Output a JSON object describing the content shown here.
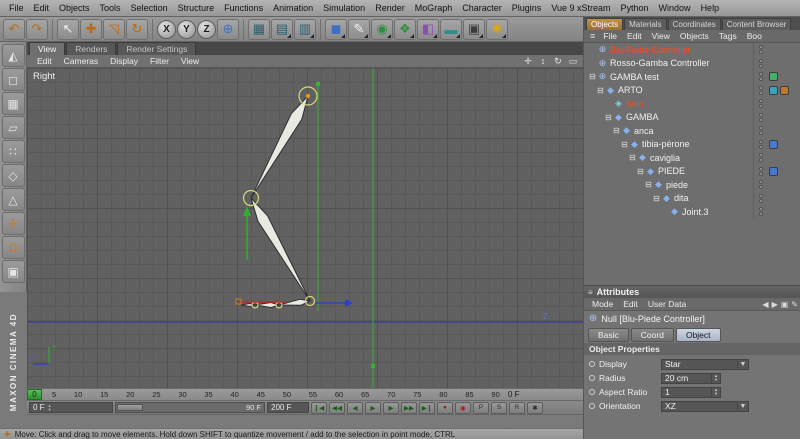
{
  "menubar": {
    "items": [
      "File",
      "Edit",
      "Objects",
      "Tools",
      "Selection",
      "Structure",
      "Functions",
      "Animation",
      "Simulation",
      "Render",
      "MoGraph",
      "Character",
      "Plugins",
      "Vue 9 xStream",
      "Python",
      "Window",
      "Help"
    ]
  },
  "toolbar": {
    "axis_x": "X",
    "axis_y": "Y",
    "axis_z": "Z"
  },
  "left_toolbar_icons": [
    "◭",
    "◻",
    "▦",
    "▱",
    "∷",
    "◇",
    "△",
    "✛",
    "Ω",
    "▣"
  ],
  "viewport": {
    "tabs": [
      "View",
      "Renders",
      "Render Settings"
    ],
    "active_tab": "View",
    "menu": [
      "Edit",
      "Cameras",
      "Display",
      "Filter",
      "View"
    ],
    "view_label": "Right",
    "axis_label_z": "Z"
  },
  "object_manager": {
    "tabs": [
      "Objects",
      "Materials",
      "Coordinates",
      "Content Browser"
    ],
    "active_tab": "Objects",
    "menu": [
      "File",
      "Edit",
      "View",
      "Objects",
      "Tags",
      "Boo"
    ],
    "tree": [
      {
        "label": "Blu-Piede Controller",
        "depth": 0,
        "icon": "null",
        "selected": true,
        "tags": []
      },
      {
        "label": "Rosso-Gamba Controller",
        "depth": 0,
        "icon": "null",
        "selected": false,
        "tags": []
      },
      {
        "label": "GAMBA test",
        "depth": 0,
        "icon": "null",
        "selected": false,
        "tags": [
          "display"
        ]
      },
      {
        "label": "ARTO",
        "depth": 1,
        "icon": "joint",
        "selected": false,
        "tags": [
          "weight",
          "xpresso"
        ]
      },
      {
        "label": "Skin",
        "depth": 2,
        "icon": "skin",
        "selected": true,
        "tags": []
      },
      {
        "label": "GAMBA",
        "depth": 2,
        "icon": "joint",
        "selected": false,
        "tags": []
      },
      {
        "label": "anca",
        "depth": 3,
        "icon": "joint",
        "selected": false,
        "tags": []
      },
      {
        "label": "tibia-pérone",
        "depth": 4,
        "icon": "joint",
        "selected": false,
        "tags": [
          "ik"
        ]
      },
      {
        "label": "caviglia",
        "depth": 5,
        "icon": "joint",
        "selected": false,
        "tags": []
      },
      {
        "label": "PIEDE",
        "depth": 6,
        "icon": "joint",
        "selected": false,
        "tags": [
          "ik"
        ]
      },
      {
        "label": "piede",
        "depth": 7,
        "icon": "joint",
        "selected": false,
        "tags": []
      },
      {
        "label": "dita",
        "depth": 8,
        "icon": "joint",
        "selected": false,
        "tags": []
      },
      {
        "label": "Joint.3",
        "depth": 9,
        "icon": "joint",
        "selected": false,
        "tags": []
      }
    ]
  },
  "attributes": {
    "title": "Attributes",
    "menu": [
      "Mode",
      "Edit",
      "User Data"
    ],
    "object_title": "Null [Blu-Piede Controller]",
    "tabs": [
      "Basic",
      "Coord",
      "Object"
    ],
    "active_tab": "Object",
    "section": "Object Properties",
    "properties": [
      {
        "label": "Display",
        "value": "Star",
        "control": "dropdown"
      },
      {
        "label": "Radius",
        "value": "20 cm",
        "control": "number"
      },
      {
        "label": "Aspect Ratio",
        "value": "1",
        "control": "number"
      },
      {
        "label": "Orientation",
        "value": "XZ",
        "control": "dropdown"
      }
    ]
  },
  "timeline": {
    "marker": "0",
    "ticks": [
      "5",
      "10",
      "15",
      "20",
      "25",
      "30",
      "35",
      "40",
      "45",
      "50",
      "55",
      "60",
      "65",
      "70",
      "75",
      "80",
      "85",
      "90"
    ],
    "ruler_frame": "0 F",
    "current_frame": "0 F",
    "range_end": "90 F",
    "max_frames": "200 F"
  },
  "status_bar": {
    "text": "Move: Click and drag to move elements. Hold down SHIFT to quantize movement / add to the selection in point mode, CTRL"
  },
  "branding": {
    "vertical_text": "MAXON CINEMA 4D"
  },
  "icons": {
    "undo": "↶",
    "redo": "↷",
    "select": "↖",
    "move": "✚",
    "scale": "◹",
    "rotate": "↻",
    "coords": "⊕",
    "render_view": "▦",
    "render_pv": "▤",
    "render_set": "▥",
    "cube": "◼",
    "spline": "✎",
    "nurbs": "◉",
    "array": "❖",
    "deformer": "◧",
    "floor": "▬",
    "camera": "▣",
    "light": "✺",
    "pan": "✛",
    "zoom": "↕",
    "rotate_view": "↻",
    "toggle_view": "▭",
    "hamburger": "≡",
    "back": "◀",
    "forward": "▶",
    "lock": "▣",
    "edit": "✎",
    "expand": "⊟",
    "dropdown_arrow": "▼",
    "spin_up": "▲",
    "spin_down": "▼",
    "goto_start": "❙◀",
    "prev_key": "◀◀",
    "prev_frame": "◀",
    "play": "▶",
    "next_frame": "▶",
    "next_key": "▶▶",
    "goto_end": "▶❙",
    "record": "●",
    "autokey": "◉",
    "key_pos": "P",
    "key_scale": "S",
    "key_rot": "R",
    "key_param": "✱",
    "status_move": "✚",
    "null_obj": "⊕",
    "joint": "◆",
    "skin": "◈"
  },
  "colors": {
    "selection_text": "#ff4a14",
    "accent_green": "#37b037",
    "horizon_blue": "#3d3d8e",
    "axis_red": "#cc2222",
    "axis_blue": "#2b3fd0",
    "active_tab_orange": "#b08040"
  }
}
